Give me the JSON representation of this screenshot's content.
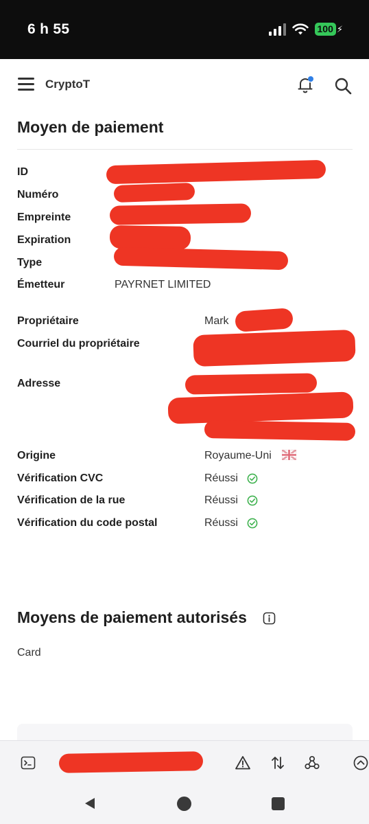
{
  "status_bar": {
    "time": "6 h 55",
    "battery": "100"
  },
  "header": {
    "app_name": "CryptoT",
    "icons": [
      "menu-icon",
      "notification-bell-icon",
      "search-icon"
    ]
  },
  "payment_method": {
    "title": "Moyen de paiement",
    "labels": {
      "id": "ID",
      "number": "Numéro",
      "fingerprint": "Empreinte",
      "expiration": "Expiration",
      "type": "Type",
      "issuer": "Émetteur",
      "owner": "Propriétaire",
      "owner_email": "Courriel du propriétaire",
      "address": "Adresse",
      "origin": "Origine",
      "cvc_check": "Vérification CVC",
      "street_check": "Vérification de la rue",
      "postal_check": "Vérification du code postal"
    },
    "values": {
      "issuer": "PAYRNET LIMITED",
      "owner_first_name": "Mark",
      "origin": "Royaume-Uni",
      "cvc_check": "Réussi",
      "street_check": "Réussi",
      "postal_check": "Réussi"
    },
    "colors": {
      "redaction": "#ee3524",
      "success": "#3fb24f"
    }
  },
  "authorized": {
    "title": "Moyens de paiement autorisés",
    "value": "Card"
  },
  "bottom_bar": {
    "icons": [
      "terminal-icon",
      "warning-icon",
      "sort-arrows-icon",
      "webhook-icon",
      "chevron-up-circle-icon"
    ]
  },
  "nav_bar": {
    "icons": [
      "back-icon",
      "home-icon",
      "recents-icon"
    ]
  }
}
